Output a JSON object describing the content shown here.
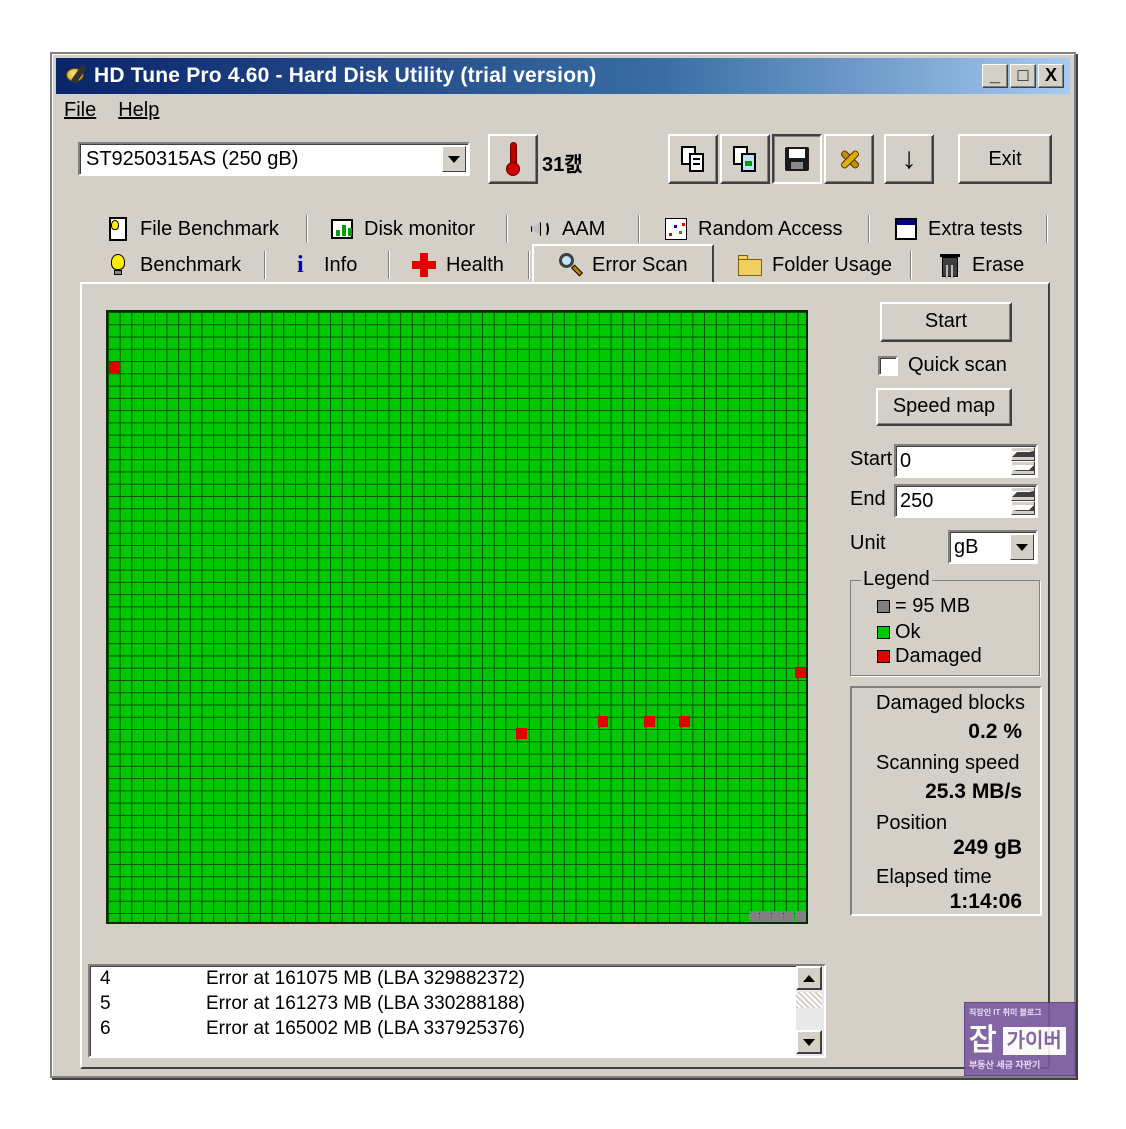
{
  "window": {
    "title": "HD Tune Pro 4.60 - Hard Disk Utility (trial version)",
    "controls": {
      "minimize": "_",
      "maximize": "□",
      "close": "X"
    }
  },
  "menu": {
    "file": "File",
    "help": "Help"
  },
  "toolbar": {
    "drive": "ST9250315AS (250 gB)",
    "temperature": "31캜",
    "exit_label": "Exit",
    "icons": [
      "copy-text-icon",
      "copy-screenshot-icon",
      "save-icon",
      "options-icon",
      "download-icon"
    ]
  },
  "tabs": {
    "top": [
      "File Benchmark",
      "Disk monitor",
      "AAM",
      "Random Access",
      "Extra tests"
    ],
    "bottom": [
      "Benchmark",
      "Info",
      "Health",
      "Error Scan",
      "Folder Usage",
      "Erase"
    ],
    "active": "Error Scan"
  },
  "controls": {
    "start_label": "Start",
    "quick_scan_label": "Quick scan",
    "quick_scan_checked": false,
    "speed_map_label": "Speed map",
    "start_field_label": "Start",
    "start_value": "0",
    "end_field_label": "End",
    "end_value": "250",
    "unit_label": "Unit",
    "unit_value": "gB"
  },
  "legend": {
    "title": "Legend",
    "block_size": "= 95 MB",
    "ok": "Ok",
    "damaged": "Damaged",
    "colors": {
      "unscanned": "#808080",
      "ok": "#00c800",
      "damaged": "#e00000"
    }
  },
  "stats": {
    "damaged_blocks_label": "Damaged blocks",
    "damaged_blocks_value": "0.2 %",
    "scanning_speed_label": "Scanning speed",
    "scanning_speed_value": "25.3 MB/s",
    "position_label": "Position",
    "position_value": "249 gB",
    "elapsed_label": "Elapsed time",
    "elapsed_value": "1:14:06"
  },
  "scan_map": {
    "columns": 60,
    "rows": 50,
    "damaged_blocks": [
      [
        0,
        4
      ],
      [
        59,
        29
      ],
      [
        35,
        34
      ],
      [
        42,
        33
      ],
      [
        46,
        33
      ],
      [
        49,
        33
      ]
    ],
    "unscanned_blocks": [
      [
        55,
        49
      ],
      [
        56,
        49
      ],
      [
        57,
        49
      ],
      [
        58,
        49
      ],
      [
        59,
        49
      ]
    ]
  },
  "log": [
    {
      "num": "4",
      "msg": "Error at 161075 MB (LBA 329882372)"
    },
    {
      "num": "5",
      "msg": "Error at 161273 MB (LBA 330288188)"
    },
    {
      "num": "6",
      "msg": "Error at 165002 MB (LBA 337925376)"
    }
  ],
  "watermark": {
    "top": "직장인 IT 취미 블로그",
    "big": "잡",
    "sub": "가이버",
    "bottom": "부동산 세금 자판기"
  }
}
